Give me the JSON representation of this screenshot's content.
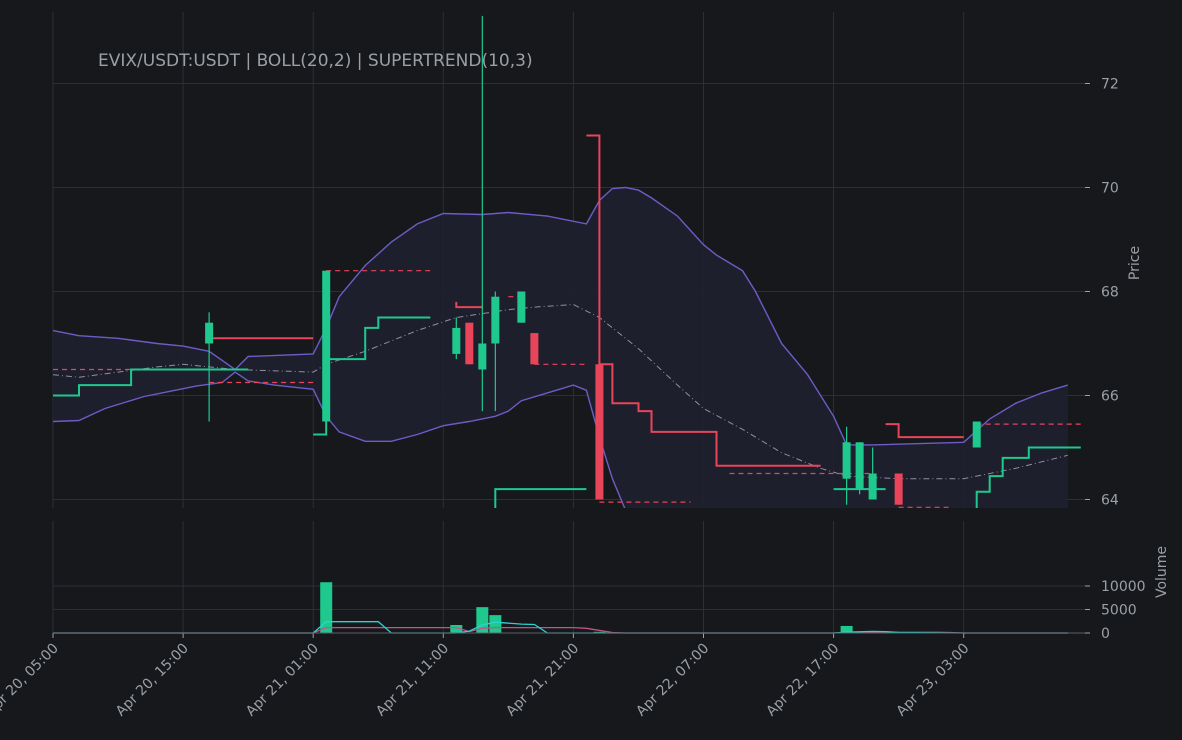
{
  "chart_data": {
    "type": "candlestick",
    "title": "EVIX/USDT:USDT | BOLL(20,2) | SUPERTREND(10,3)",
    "ylabel_price": "Price",
    "ylabel_volume": "Volume",
    "x_ticks": [
      "Apr 20, 05:00",
      "Apr 20, 15:00",
      "Apr 21, 01:00",
      "Apr 21, 11:00",
      "Apr 21, 21:00",
      "Apr 22, 07:00",
      "Apr 22, 17:00",
      "Apr 23, 03:00"
    ],
    "price_ticks": [
      64,
      66,
      68,
      70,
      72
    ],
    "volume_ticks": [
      0,
      5000,
      10000
    ],
    "price_ylim": [
      63.4,
      73.2
    ],
    "volume_ylim": [
      0,
      10000
    ],
    "grid": true,
    "colors": {
      "background": "#16181c",
      "grid": "#2c3035",
      "up": "#1fc98e",
      "down": "#e8445a",
      "band": "#6e5bc6",
      "band_fill": "#1f2030",
      "mid": "#8f8fa0",
      "vol_ma_cyan": "#2ad4d0",
      "vol_ma_pink": "#c9508a"
    },
    "candles": [
      {
        "t": "2024-04-20 17:00",
        "o": 67.0,
        "h": 67.6,
        "l": 65.5,
        "c": 67.4
      },
      {
        "t": "2024-04-21 02:00",
        "o": 65.5,
        "h": 68.4,
        "l": 65.5,
        "c": 68.4
      },
      {
        "t": "2024-04-21 12:00",
        "o": 66.8,
        "h": 67.5,
        "l": 66.7,
        "c": 67.3
      },
      {
        "t": "2024-04-21 13:00",
        "o": 67.4,
        "h": 67.4,
        "l": 66.6,
        "c": 66.6
      },
      {
        "t": "2024-04-21 14:00",
        "o": 66.5,
        "h": 73.3,
        "l": 65.7,
        "c": 67.0
      },
      {
        "t": "2024-04-21 15:00",
        "o": 67.0,
        "h": 68.0,
        "l": 65.7,
        "c": 67.9
      },
      {
        "t": "2024-04-21 17:00",
        "o": 67.4,
        "h": 68.0,
        "l": 67.4,
        "c": 68.0
      },
      {
        "t": "2024-04-21 18:00",
        "o": 67.2,
        "h": 67.2,
        "l": 66.6,
        "c": 66.6
      },
      {
        "t": "2024-04-21 23:00",
        "o": 66.6,
        "h": 71.0,
        "l": 64.0,
        "c": 64.0
      },
      {
        "t": "2024-04-22 18:00",
        "o": 64.4,
        "h": 65.4,
        "l": 63.9,
        "c": 65.1
      },
      {
        "t": "2024-04-22 19:00",
        "o": 64.2,
        "h": 65.1,
        "l": 64.1,
        "c": 65.1
      },
      {
        "t": "2024-04-22 20:00",
        "o": 64.0,
        "h": 65.0,
        "l": 64.0,
        "c": 64.5
      },
      {
        "t": "2024-04-22 22:00",
        "o": 64.5,
        "h": 64.5,
        "l": 63.9,
        "c": 63.9
      },
      {
        "t": "2024-04-23 04:00",
        "o": 65.0,
        "h": 65.5,
        "l": 65.0,
        "c": 65.5
      }
    ],
    "volume": [
      {
        "t": "2024-04-21 02:00",
        "v": 10800,
        "dir": "up"
      },
      {
        "t": "2024-04-21 12:00",
        "v": 1700,
        "dir": "up"
      },
      {
        "t": "2024-04-21 14:00",
        "v": 5500,
        "dir": "up"
      },
      {
        "t": "2024-04-21 15:00",
        "v": 3800,
        "dir": "up"
      },
      {
        "t": "2024-04-21 23:00",
        "v": 250,
        "dir": "up"
      },
      {
        "t": "2024-04-22 18:00",
        "v": 1500,
        "dir": "up"
      },
      {
        "t": "2024-04-22 19:00",
        "v": 200,
        "dir": "up"
      }
    ],
    "boll_upper": [
      [
        "2024-04-20 05:00",
        67.25
      ],
      [
        "2024-04-20 07:00",
        67.15
      ],
      [
        "2024-04-20 10:00",
        67.1
      ],
      [
        "2024-04-20 13:00",
        67.0
      ],
      [
        "2024-04-20 15:00",
        66.95
      ],
      [
        "2024-04-20 17:00",
        66.85
      ],
      [
        "2024-04-20 19:00",
        66.5
      ],
      [
        "2024-04-20 20:00",
        66.75
      ],
      [
        "2024-04-21 01:00",
        66.8
      ],
      [
        "2024-04-21 02:00",
        67.3
      ],
      [
        "2024-04-21 03:00",
        67.9
      ],
      [
        "2024-04-21 05:00",
        68.5
      ],
      [
        "2024-04-21 07:00",
        68.95
      ],
      [
        "2024-04-21 09:00",
        69.3
      ],
      [
        "2024-04-21 11:00",
        69.5
      ],
      [
        "2024-04-21 14:00",
        69.48
      ],
      [
        "2024-04-21 16:00",
        69.52
      ],
      [
        "2024-04-21 19:00",
        69.45
      ],
      [
        "2024-04-21 22:00",
        69.3
      ],
      [
        "2024-04-21 23:00",
        69.75
      ],
      [
        "2024-04-22 00:00",
        69.98
      ],
      [
        "2024-04-22 01:00",
        70.0
      ],
      [
        "2024-04-22 02:00",
        69.95
      ],
      [
        "2024-04-22 03:00",
        69.8
      ],
      [
        "2024-04-22 05:00",
        69.45
      ],
      [
        "2024-04-22 07:00",
        68.9
      ],
      [
        "2024-04-22 08:00",
        68.7
      ],
      [
        "2024-04-22 09:00",
        68.55
      ],
      [
        "2024-04-22 10:00",
        68.4
      ],
      [
        "2024-04-22 11:00",
        68.0
      ],
      [
        "2024-04-22 13:00",
        67.0
      ],
      [
        "2024-04-22 15:00",
        66.4
      ],
      [
        "2024-04-22 17:00",
        65.6
      ],
      [
        "2024-04-22 18:00",
        65.05
      ],
      [
        "2024-04-22 20:00",
        65.05
      ],
      [
        "2024-04-23 03:00",
        65.1
      ],
      [
        "2024-04-23 05:00",
        65.55
      ],
      [
        "2024-04-23 07:00",
        65.85
      ],
      [
        "2024-04-23 09:00",
        66.05
      ],
      [
        "2024-04-23 11:00",
        66.2
      ]
    ],
    "boll_lower": [
      [
        "2024-04-20 05:00",
        65.5
      ],
      [
        "2024-04-20 07:00",
        65.52
      ],
      [
        "2024-04-20 09:00",
        65.75
      ],
      [
        "2024-04-20 12:00",
        65.98
      ],
      [
        "2024-04-20 14:00",
        66.08
      ],
      [
        "2024-04-20 16:00",
        66.18
      ],
      [
        "2024-04-20 18:00",
        66.25
      ],
      [
        "2024-04-20 19:00",
        66.45
      ],
      [
        "2024-04-20 20:00",
        66.28
      ],
      [
        "2024-04-20 22:00",
        66.2
      ],
      [
        "2024-04-21 01:00",
        66.12
      ],
      [
        "2024-04-21 02:00",
        65.6
      ],
      [
        "2024-04-21 03:00",
        65.3
      ],
      [
        "2024-04-21 05:00",
        65.12
      ],
      [
        "2024-04-21 07:00",
        65.12
      ],
      [
        "2024-04-21 09:00",
        65.25
      ],
      [
        "2024-04-21 11:00",
        65.42
      ],
      [
        "2024-04-21 13:00",
        65.5
      ],
      [
        "2024-04-21 15:00",
        65.6
      ],
      [
        "2024-04-21 16:00",
        65.7
      ],
      [
        "2024-04-21 17:00",
        65.9
      ],
      [
        "2024-04-21 19:00",
        66.05
      ],
      [
        "2024-04-21 21:00",
        66.2
      ],
      [
        "2024-04-21 22:00",
        66.1
      ],
      [
        "2024-04-21 23:00",
        65.2
      ],
      [
        "2024-04-22 00:00",
        64.4
      ],
      [
        "2024-04-22 01:00",
        63.8
      ],
      [
        "2024-04-22 02:00",
        63.5
      ]
    ],
    "boll_mid": [
      [
        "2024-04-20 05:00",
        66.4
      ],
      [
        "2024-04-20 07:00",
        66.35
      ],
      [
        "2024-04-20 10:00",
        66.45
      ],
      [
        "2024-04-20 13:00",
        66.55
      ],
      [
        "2024-04-20 15:00",
        66.6
      ],
      [
        "2024-04-20 17:00",
        66.55
      ],
      [
        "2024-04-20 19:00",
        66.5
      ],
      [
        "2024-04-21 01:00",
        66.45
      ],
      [
        "2024-04-21 02:00",
        66.6
      ],
      [
        "2024-04-21 05:00",
        66.85
      ],
      [
        "2024-04-21 09:00",
        67.25
      ],
      [
        "2024-04-21 12:00",
        67.5
      ],
      [
        "2024-04-21 16:00",
        67.65
      ],
      [
        "2024-04-21 18:00",
        67.7
      ],
      [
        "2024-04-21 21:00",
        67.75
      ],
      [
        "2024-04-21 23:00",
        67.5
      ],
      [
        "2024-04-22 02:00",
        66.9
      ],
      [
        "2024-04-22 05:00",
        66.2
      ],
      [
        "2024-04-22 07:00",
        65.75
      ],
      [
        "2024-04-22 10:00",
        65.35
      ],
      [
        "2024-04-22 13:00",
        64.9
      ],
      [
        "2024-04-22 16:00",
        64.6
      ],
      [
        "2024-04-22 18:00",
        64.45
      ],
      [
        "2024-04-22 22:00",
        64.4
      ],
      [
        "2024-04-23 03:00",
        64.4
      ],
      [
        "2024-04-23 07:00",
        64.6
      ],
      [
        "2024-04-23 11:00",
        64.85
      ]
    ],
    "supertrend_segments": [
      {
        "dir": "up",
        "style": "solid",
        "points": [
          [
            "2024-04-20 05:00",
            66.0
          ],
          [
            "2024-04-20 07:00",
            66.0
          ],
          [
            "2024-04-20 07:00",
            66.2
          ],
          [
            "2024-04-20 11:00",
            66.2
          ],
          [
            "2024-04-20 11:00",
            66.5
          ],
          [
            "2024-04-20 20:00",
            66.5
          ]
        ]
      },
      {
        "dir": "down",
        "style": "dashed",
        "points": [
          [
            "2024-04-20 05:00",
            66.5
          ],
          [
            "2024-04-20 11:00",
            66.5
          ]
        ]
      },
      {
        "dir": "down",
        "style": "solid",
        "points": [
          [
            "2024-04-20 17:00",
            67.1
          ],
          [
            "2024-04-21 01:00",
            67.1
          ]
        ]
      },
      {
        "dir": "down",
        "style": "dashed",
        "points": [
          [
            "2024-04-20 17:00",
            66.25
          ],
          [
            "2024-04-21 01:00",
            66.25
          ]
        ]
      },
      {
        "dir": "up",
        "style": "solid",
        "points": [
          [
            "2024-04-21 01:00",
            65.25
          ],
          [
            "2024-04-21 02:00",
            65.25
          ],
          [
            "2024-04-21 02:00",
            66.7
          ],
          [
            "2024-04-21 05:00",
            66.7
          ],
          [
            "2024-04-21 05:00",
            67.3
          ],
          [
            "2024-04-21 06:00",
            67.3
          ],
          [
            "2024-04-21 06:00",
            67.5
          ],
          [
            "2024-04-21 10:00",
            67.5
          ]
        ]
      },
      {
        "dir": "down",
        "style": "dashed",
        "points": [
          [
            "2024-04-21 02:00",
            68.4
          ],
          [
            "2024-04-21 10:00",
            68.4
          ]
        ]
      },
      {
        "dir": "down",
        "style": "solid",
        "points": [
          [
            "2024-04-21 12:00",
            67.8
          ],
          [
            "2024-04-21 12:00",
            67.7
          ],
          [
            "2024-04-21 14:00",
            67.7
          ]
        ]
      },
      {
        "dir": "down",
        "style": "dashed",
        "points": [
          [
            "2024-04-21 16:00",
            67.9
          ],
          [
            "2024-04-21 17:00",
            67.9
          ]
        ]
      },
      {
        "dir": "up",
        "style": "solid",
        "points": [
          [
            "2024-04-21 15:00",
            63.8
          ],
          [
            "2024-04-21 15:00",
            64.2
          ],
          [
            "2024-04-21 22:00",
            64.2
          ]
        ]
      },
      {
        "dir": "down",
        "style": "dashed",
        "points": [
          [
            "2024-04-21 18:00",
            66.6
          ],
          [
            "2024-04-21 22:00",
            66.6
          ]
        ]
      },
      {
        "dir": "down",
        "style": "solid",
        "points": [
          [
            "2024-04-21 22:00",
            71.0
          ],
          [
            "2024-04-21 23:00",
            71.0
          ],
          [
            "2024-04-21 23:00",
            66.6
          ],
          [
            "2024-04-22 00:00",
            66.6
          ],
          [
            "2024-04-22 00:00",
            65.85
          ],
          [
            "2024-04-22 02:00",
            65.85
          ],
          [
            "2024-04-22 02:00",
            65.7
          ],
          [
            "2024-04-22 03:00",
            65.7
          ],
          [
            "2024-04-22 03:00",
            65.3
          ],
          [
            "2024-04-22 08:00",
            65.3
          ],
          [
            "2024-04-22 08:00",
            64.65
          ],
          [
            "2024-04-22 16:00",
            64.65
          ]
        ]
      },
      {
        "dir": "down",
        "style": "dashed",
        "points": [
          [
            "2024-04-21 23:00",
            63.95
          ],
          [
            "2024-04-22 06:00",
            63.95
          ]
        ]
      },
      {
        "dir": "down",
        "style": "dashed",
        "points": [
          [
            "2024-04-22 09:00",
            64.5
          ],
          [
            "2024-04-22 20:00",
            64.5
          ]
        ]
      },
      {
        "dir": "up",
        "style": "solid",
        "points": [
          [
            "2024-04-22 17:00",
            64.2
          ],
          [
            "2024-04-22 21:00",
            64.2
          ]
        ]
      },
      {
        "dir": "down",
        "style": "solid",
        "points": [
          [
            "2024-04-22 21:00",
            65.45
          ],
          [
            "2024-04-22 22:00",
            65.45
          ],
          [
            "2024-04-22 22:00",
            65.2
          ],
          [
            "2024-04-23 03:00",
            65.2
          ]
        ]
      },
      {
        "dir": "down",
        "style": "dashed",
        "points": [
          [
            "2024-04-22 22:00",
            63.85
          ],
          [
            "2024-04-23 02:00",
            63.85
          ]
        ]
      },
      {
        "dir": "up",
        "style": "solid",
        "points": [
          [
            "2024-04-23 04:00",
            63.8
          ],
          [
            "2024-04-23 04:00",
            64.15
          ],
          [
            "2024-04-23 05:00",
            64.15
          ],
          [
            "2024-04-23 05:00",
            64.45
          ],
          [
            "2024-04-23 06:00",
            64.45
          ],
          [
            "2024-04-23 06:00",
            64.8
          ],
          [
            "2024-04-23 08:00",
            64.8
          ],
          [
            "2024-04-23 08:00",
            65.0
          ],
          [
            "2024-04-23 12:00",
            65.0
          ]
        ]
      },
      {
        "dir": "down",
        "style": "dashed",
        "points": [
          [
            "2024-04-23 04:00",
            65.45
          ],
          [
            "2024-04-23 12:00",
            65.45
          ]
        ]
      }
    ],
    "volume_ma_cyan": [
      [
        "2024-04-20 05:00",
        0
      ],
      [
        "2024-04-21 01:00",
        0
      ],
      [
        "2024-04-21 02:00",
        2400
      ],
      [
        "2024-04-21 06:00",
        2400
      ],
      [
        "2024-04-21 07:00",
        0
      ],
      [
        "2024-04-21 12:00",
        0
      ],
      [
        "2024-04-21 13:00",
        400
      ],
      [
        "2024-04-21 14:00",
        1700
      ],
      [
        "2024-04-21 15:00",
        2300
      ],
      [
        "2024-04-21 17:00",
        1900
      ],
      [
        "2024-04-21 18:00",
        1800
      ],
      [
        "2024-04-21 19:00",
        0
      ],
      [
        "2024-04-22 17:00",
        0
      ],
      [
        "2024-04-22 18:00",
        200
      ],
      [
        "2024-04-22 20:00",
        350
      ],
      [
        "2024-04-22 21:00",
        300
      ],
      [
        "2024-04-22 22:00",
        100
      ],
      [
        "2024-04-23 03:00",
        0
      ],
      [
        "2024-04-23 11:00",
        0
      ]
    ],
    "volume_ma_pink": [
      [
        "2024-04-20 05:00",
        0
      ],
      [
        "2024-04-21 01:00",
        0
      ],
      [
        "2024-04-21 02:00",
        1150
      ],
      [
        "2024-04-21 12:00",
        1150
      ],
      [
        "2024-04-21 13:00",
        300
      ],
      [
        "2024-04-21 14:00",
        1000
      ],
      [
        "2024-04-21 15:00",
        1150
      ],
      [
        "2024-04-21 21:00",
        1150
      ],
      [
        "2024-04-21 22:00",
        1000
      ],
      [
        "2024-04-22 00:00",
        100
      ],
      [
        "2024-04-22 01:00",
        0
      ],
      [
        "2024-04-22 17:00",
        0
      ],
      [
        "2024-04-22 18:00",
        150
      ],
      [
        "2024-04-22 20:00",
        150
      ],
      [
        "2024-04-23 01:00",
        150
      ],
      [
        "2024-04-23 02:00",
        100
      ],
      [
        "2024-04-23 03:00",
        0
      ],
      [
        "2024-04-23 11:00",
        0
      ]
    ]
  }
}
